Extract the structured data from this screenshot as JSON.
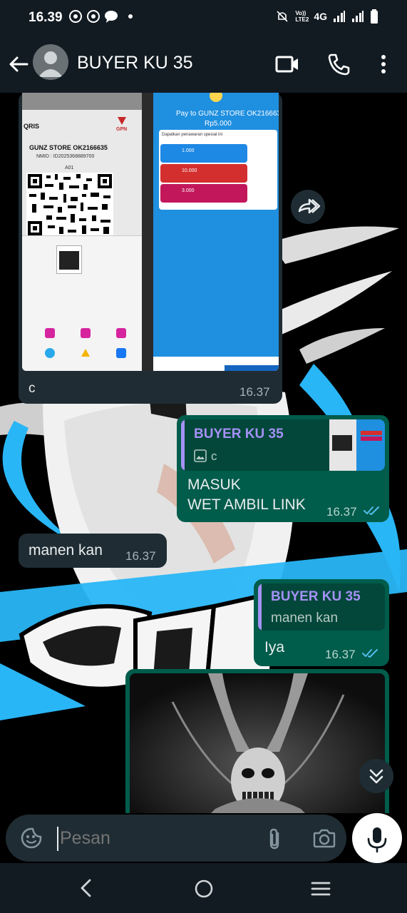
{
  "status": {
    "time": "16.39",
    "network_label": "4G",
    "volte_label": "Vo)) LTE2"
  },
  "header": {
    "contact_name": "BUYER KU 35"
  },
  "messages": {
    "image_message": {
      "caption": "c",
      "time": "16.37",
      "preview_left": {
        "store_name": "GUNZ STORE OK2166635",
        "nmid": "NMID : ID2025368889700",
        "code": "A01",
        "qris_label": "QRIS",
        "gpn_label": "GPN"
      },
      "preview_right": {
        "pay_to": "Pay to GUNZ STORE OK2166635",
        "amount": "Rp5.000",
        "offer_title": "Dapatkan penawaran spesial ini",
        "offers": [
          "1.000",
          "10.000",
          "3.000"
        ]
      }
    },
    "reply_message_1": {
      "quoted_name": "BUYER KU 35",
      "quoted_text": "c",
      "text_line1": "MASUK",
      "text_line2": "WET AMBIL LINK",
      "time": "16.37"
    },
    "incoming_message": {
      "text": "manen kan",
      "time": "16.37"
    },
    "reply_message_2": {
      "quoted_name": "BUYER KU 35",
      "quoted_text": "manen kan",
      "text": "Iya",
      "time": "16.37"
    }
  },
  "input": {
    "placeholder": "Pesan"
  },
  "colors": {
    "header_bg": "#121b22",
    "bubble_in": "#1f2c33",
    "bubble_out": "#005c4b",
    "quote_accent": "#a591f5",
    "read_ticks": "#53bdeb"
  },
  "icons": [
    "back-arrow-icon",
    "avatar-icon",
    "video-call-icon",
    "phone-icon",
    "more-vert-icon",
    "forward-icon",
    "double-check-icon",
    "scroll-down-icon",
    "sticker-icon",
    "attach-icon",
    "camera-icon",
    "mic-icon"
  ]
}
